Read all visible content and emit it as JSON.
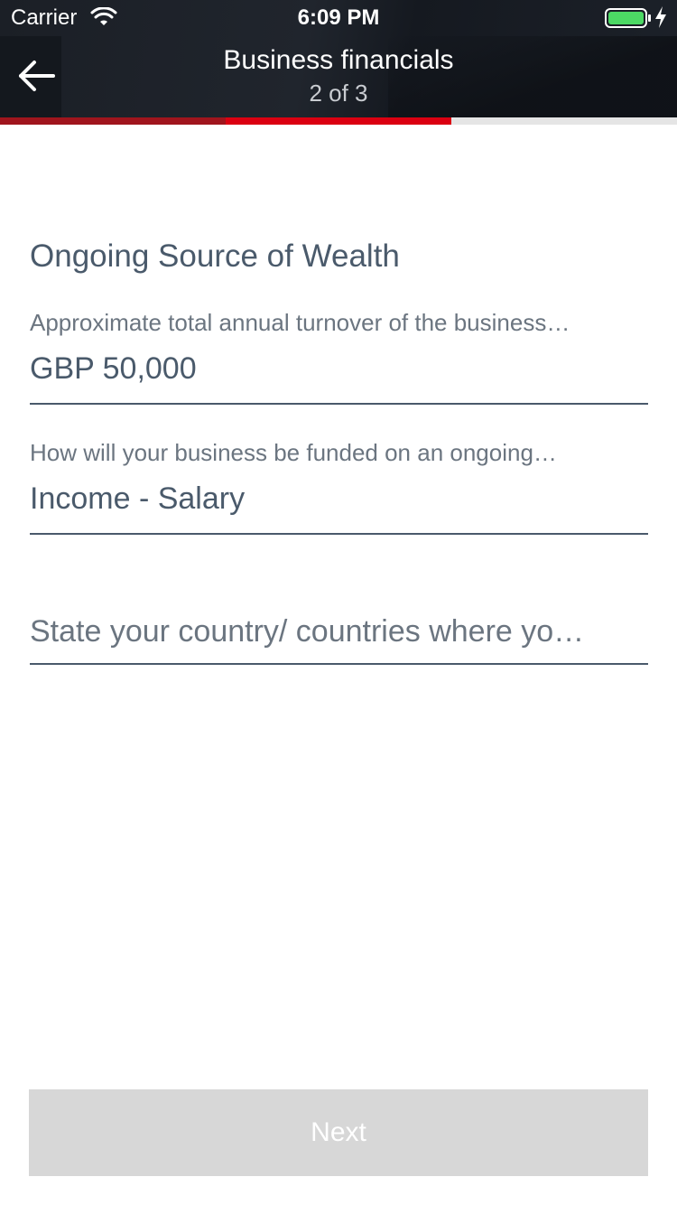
{
  "status_bar": {
    "carrier": "Carrier",
    "time": "6:09 PM",
    "wifi_icon": "wifi-icon",
    "battery_icon": "battery-charging-icon",
    "battery_color": "#4cd964"
  },
  "nav": {
    "back_icon": "arrow-left-icon",
    "title": "Business financials",
    "step": "2 of 3"
  },
  "progress": {
    "total_steps": 3,
    "current_step": 2,
    "completed_color": "#a0151d",
    "active_color": "#db0011",
    "remaining_color": "#e5e5e5"
  },
  "form": {
    "section_title": "Ongoing Source of Wealth",
    "turnover": {
      "label": "Approximate total annual turnover of the business…",
      "value": "GBP 50,000"
    },
    "funding": {
      "label": "How will your business be funded on an ongoing…",
      "value": "Income - Salary"
    },
    "countries": {
      "placeholder": "State your country/ countries where yo…"
    }
  },
  "footer": {
    "next_label": "Next",
    "next_bg": "#d7d7d7"
  }
}
